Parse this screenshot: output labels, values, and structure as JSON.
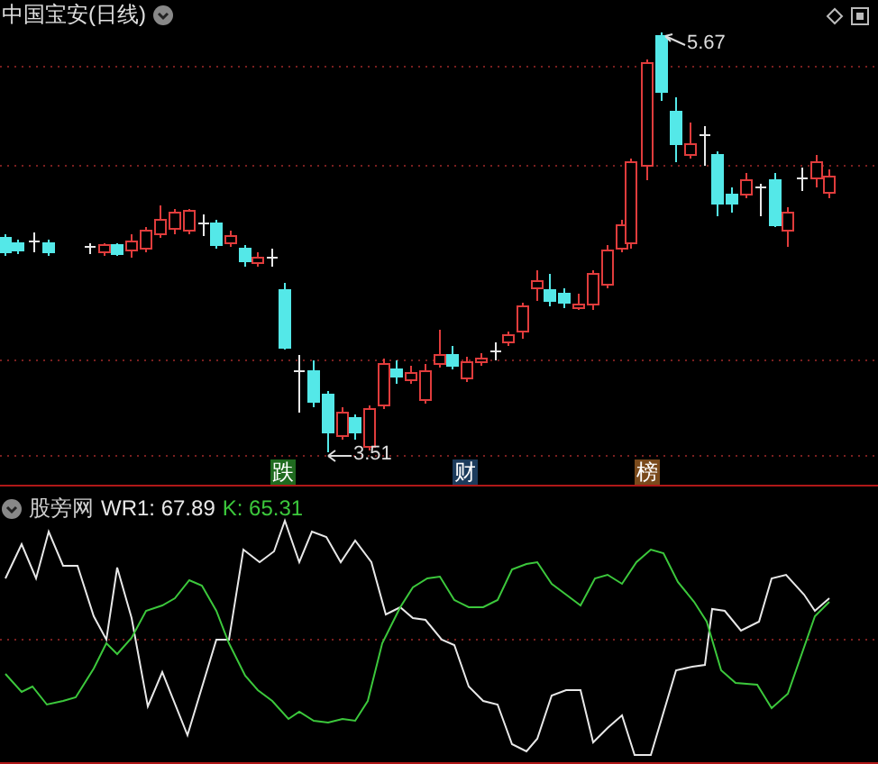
{
  "chart": {
    "title": "中国宝安(日线)",
    "high_label": "5.67",
    "low_label": "3.51",
    "markers": [
      {
        "text": "跌",
        "color": "#1f6b1f"
      },
      {
        "text": "财",
        "color": "#1c3b5c"
      },
      {
        "text": "榜",
        "color": "#7a4a1c"
      }
    ]
  },
  "indicator": {
    "name": "股旁网",
    "readings": [
      {
        "label": "WR1: 67.89",
        "color": "#e8e8e8"
      },
      {
        "label": "K: 65.31",
        "color": "#3cc83c"
      }
    ]
  }
}
